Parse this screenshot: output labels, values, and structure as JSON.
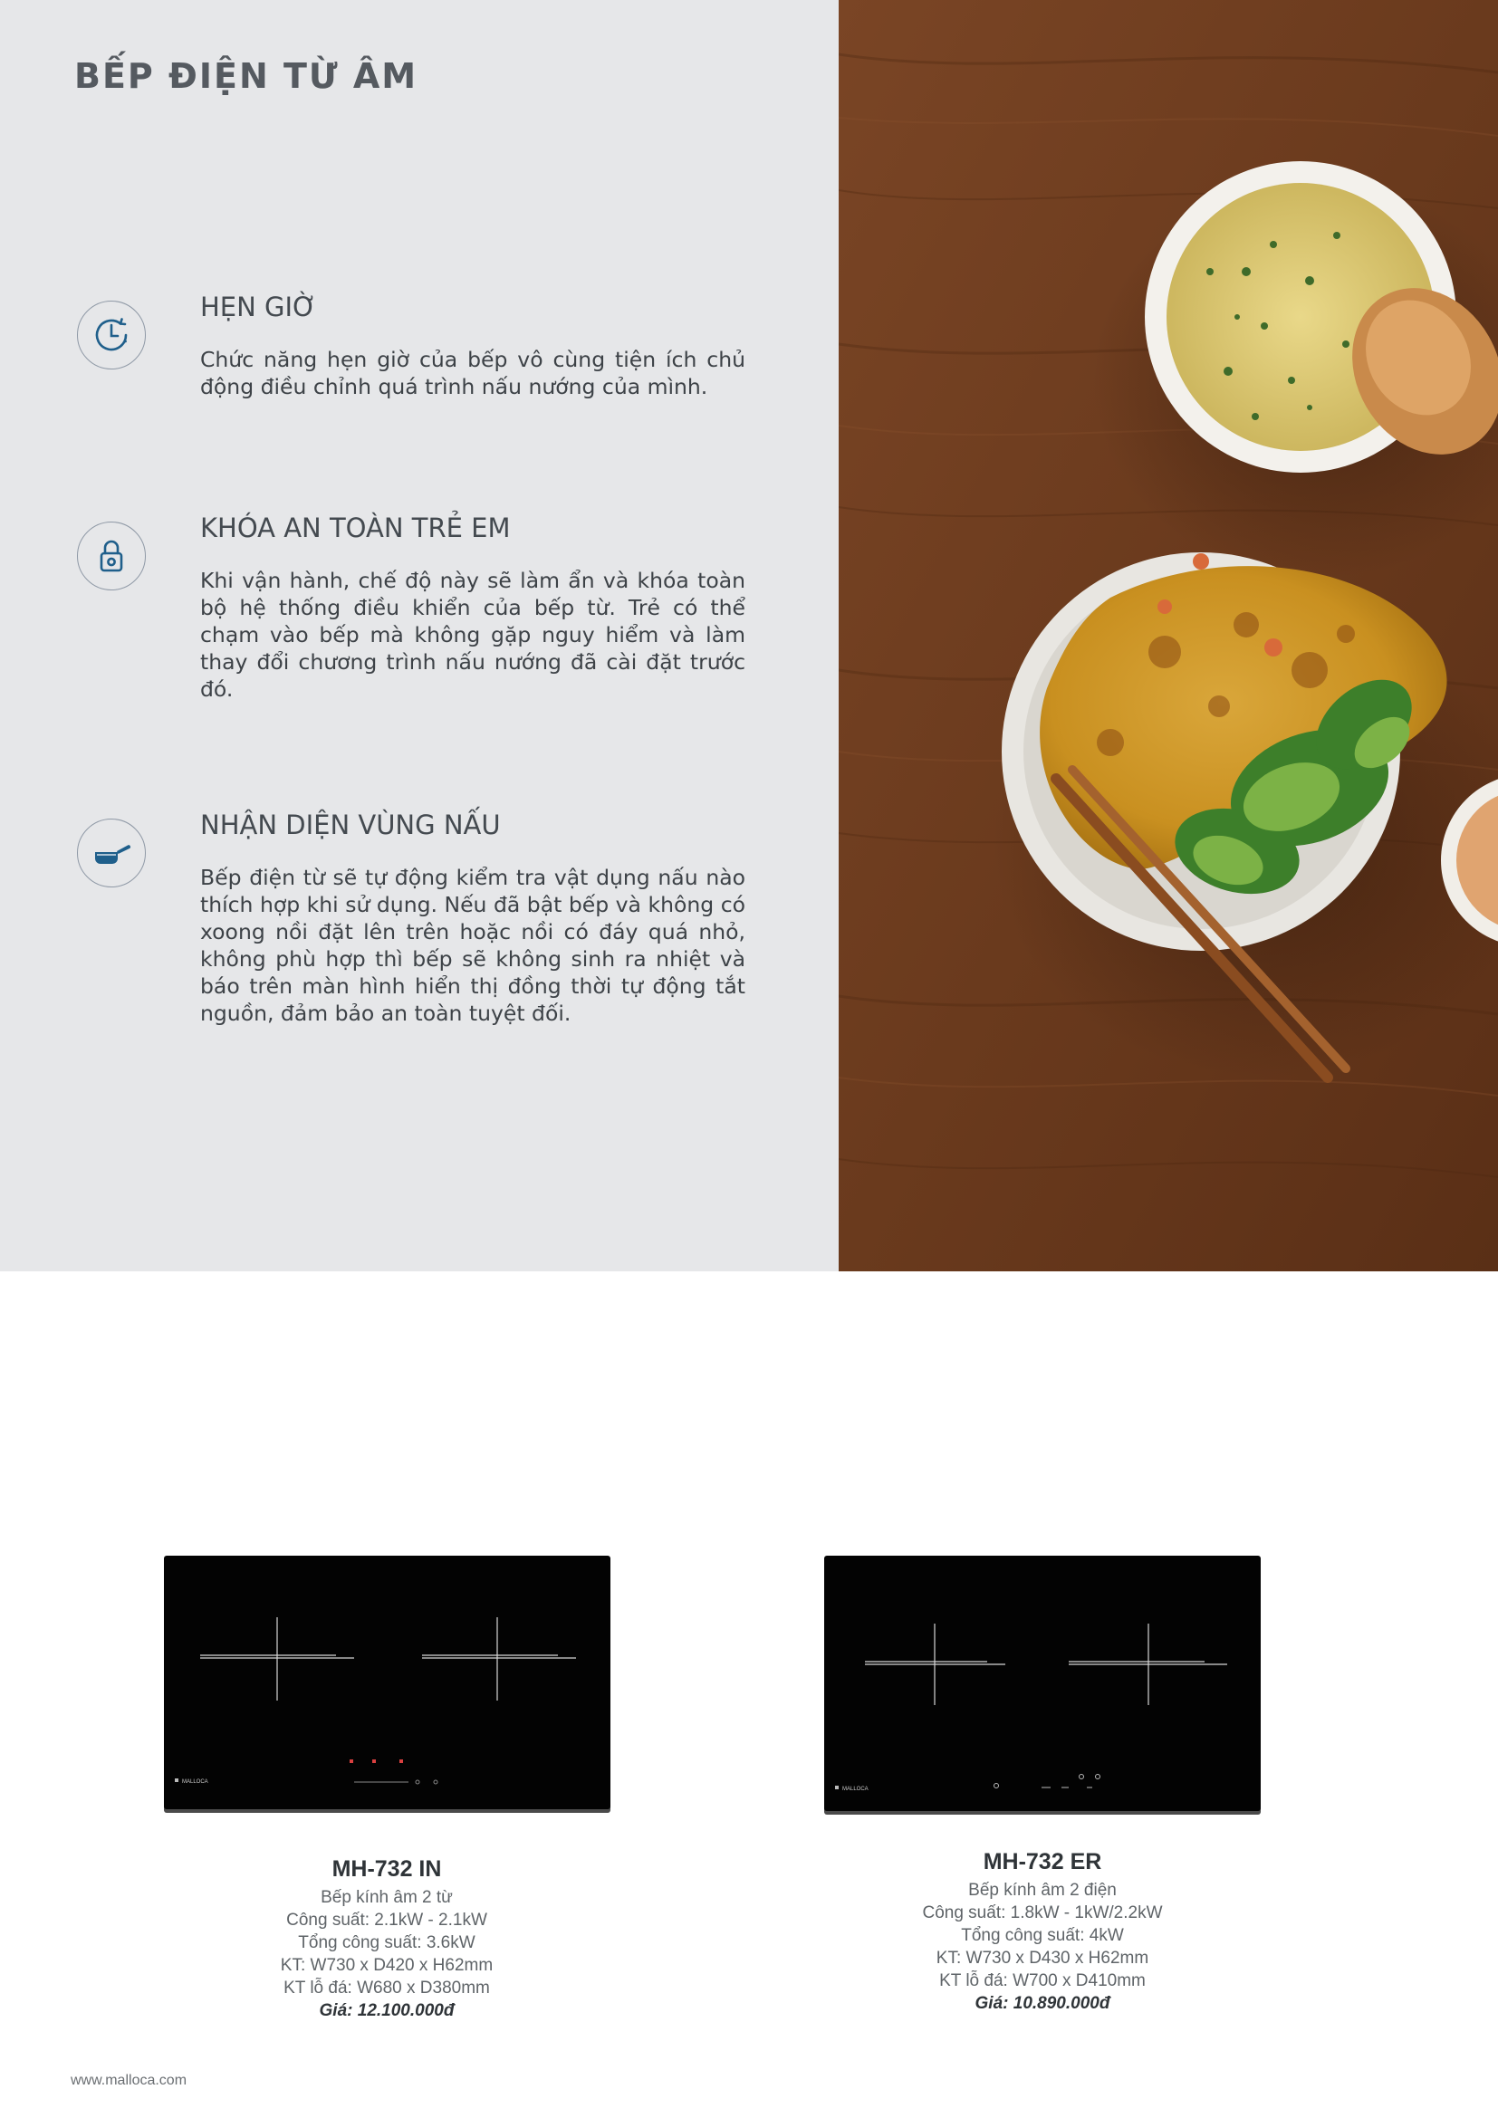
{
  "page": {
    "title": "BẾP ĐIỆN TỪ ÂM",
    "footer_url": "www.malloca.com"
  },
  "features": [
    {
      "icon": "timer-icon",
      "title": "HẸN GIỜ",
      "description": "Chức năng hẹn giờ của bếp vô cùng tiện ích chủ động điều chỉnh quá trình nấu nướng của mình."
    },
    {
      "icon": "lock-icon",
      "title": "KHÓA AN TOÀN TRẺ EM",
      "description": "Khi vận hành, chế độ này sẽ làm ẩn và khóa toàn bộ hệ thống điều khiển của bếp từ. Trẻ có thể chạm vào  bếp mà không gặp nguy hiểm và làm thay đổi chương trình nấu nướng đã cài đặt trước đó."
    },
    {
      "icon": "saucepan-icon",
      "title": "NHẬN DIỆN VÙNG NẤU",
      "description": "Bếp điện từ sẽ tự động kiểm tra vật dụng nấu nào thích hợp khi sử dụng. Nếu đã bật bếp và không có xoong nồi đặt lên trên hoặc nồi có đáy quá nhỏ, không phù hợp thì bếp sẽ không sinh ra nhiệt và báo trên màn hình hiển thị đồng thời tự động tắt nguồn, đảm bảo an toàn tuyệt đối."
    }
  ],
  "products": [
    {
      "brand": "MALLOCA",
      "model": "MH-732 IN",
      "type": "Bếp kính âm 2 từ",
      "power": "Công suất: 2.1kW - 2.1kW",
      "total_power": "Tổng công suất: 3.6kW",
      "size": "KT: W730 x D420 x H62mm",
      "cutout": "KT lỗ đá: W680 x D380mm",
      "price": "Giá: 12.100.000đ"
    },
    {
      "brand": "MALLOCA",
      "model": "MH-732 ER",
      "type": "Bếp kính âm 2 điện",
      "power": "Công suất: 1.8kW - 1kW/2.2kW",
      "total_power": "Tổng công suất: 4kW",
      "size": "KT: W730 x D430 x H62mm",
      "cutout": "KT lỗ đá: W700 x D410mm",
      "price": "Giá: 10.890.000đ"
    }
  ],
  "colors": {
    "panel_bg": "#e6e7e9",
    "icon_blue": "#1f5f8b",
    "wood": "#6b3a1c"
  }
}
